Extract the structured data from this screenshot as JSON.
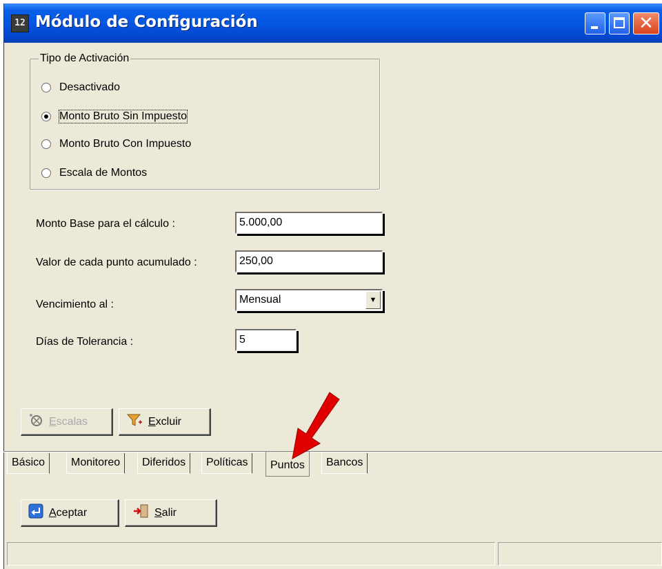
{
  "window": {
    "title": "Módulo de Configuración",
    "app_icon": "12"
  },
  "activation": {
    "legend": "Tipo de Activación",
    "options": [
      {
        "label": "Desactivado",
        "selected": false
      },
      {
        "label": "Monto Bruto Sin Impuesto",
        "selected": true
      },
      {
        "label": "Monto Bruto Con Impuesto",
        "selected": false
      },
      {
        "label": "Escala de Montos",
        "selected": false
      }
    ]
  },
  "fields": {
    "monto_base": {
      "label": "Monto Base para el cálculo :",
      "value": "5.000,00"
    },
    "valor_punto": {
      "label": "Valor de cada punto acumulado :",
      "value": "250,00"
    },
    "vencimiento": {
      "label": "Vencimiento  al :",
      "value": "Mensual"
    },
    "dias_tolerancia": {
      "label": "Días de Tolerancia :",
      "value": "5"
    }
  },
  "buttons": {
    "escalas": {
      "label": "Escalas",
      "enabled": false
    },
    "excluir": {
      "label": "Excluir",
      "enabled": true
    },
    "aceptar": {
      "label": "Aceptar"
    },
    "salir": {
      "label": "Salir"
    }
  },
  "tabs": [
    {
      "label": "Básico",
      "active": false
    },
    {
      "label": "Monitoreo",
      "active": false
    },
    {
      "label": "Diferidos",
      "active": false
    },
    {
      "label": "Políticas",
      "active": false
    },
    {
      "label": "Puntos",
      "active": true
    },
    {
      "label": "Bancos",
      "active": false
    }
  ],
  "colors": {
    "window_bg": "#ECE9D8",
    "titlebar": "#0556E0",
    "annotation_arrow": "#E00000"
  },
  "icons": {
    "close": "✕",
    "dropdown": "▼"
  }
}
